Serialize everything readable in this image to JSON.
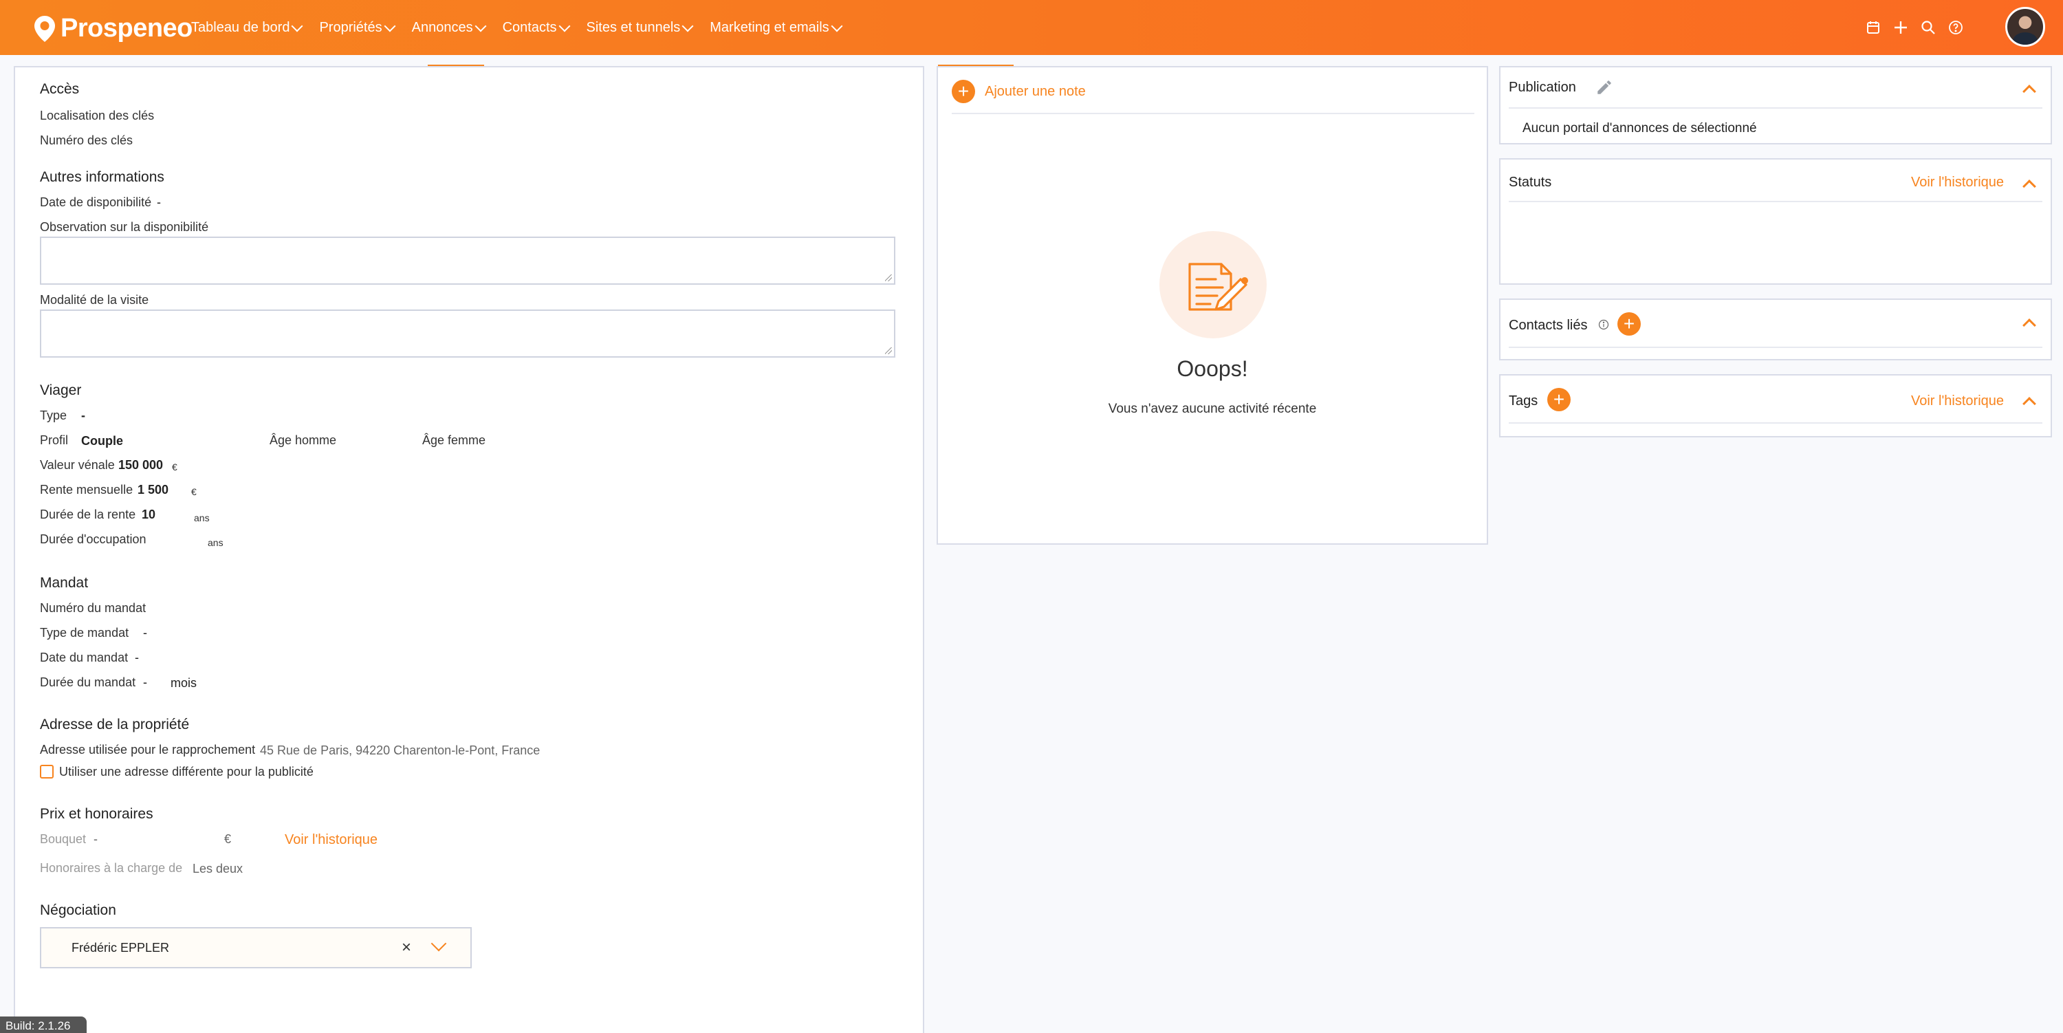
{
  "brand": {
    "name": "Prospeneo"
  },
  "nav": {
    "items": [
      {
        "label": "Tableau de bord"
      },
      {
        "label": "Propriétés"
      },
      {
        "label": "Annonces"
      },
      {
        "label": "Contacts"
      },
      {
        "label": "Sites et tunnels"
      },
      {
        "label": "Marketing et emails"
      }
    ]
  },
  "acces": {
    "title": "Accès",
    "localisation_cles": "Localisation des clés",
    "numero_cles": "Numéro des clés"
  },
  "autres": {
    "title": "Autres informations",
    "date_dispo_label": "Date de disponibilité",
    "date_dispo_value": "-",
    "observation_label": "Observation sur la disponibilité",
    "modalite_label": "Modalité de la visite"
  },
  "viager": {
    "title": "Viager",
    "type_label": "Type",
    "type_value": "-",
    "profil_label": "Profil",
    "profil_value": "Couple",
    "age_homme_label": "Âge homme",
    "age_femme_label": "Âge femme",
    "valeur_label": "Valeur vénale",
    "valeur_value": "150 000",
    "valeur_unit": "€",
    "rente_label": "Rente mensuelle",
    "rente_value": "1 500",
    "rente_unit": "€",
    "duree_rente_label": "Durée de la rente",
    "duree_rente_value": "10",
    "duree_rente_unit": "ans",
    "duree_occupation_label": "Durée d'occupation",
    "duree_occupation_unit": "ans"
  },
  "mandat": {
    "title": "Mandat",
    "numero_label": "Numéro du mandat",
    "type_label": "Type de mandat",
    "type_value": "-",
    "date_label": "Date du mandat",
    "date_value": "-",
    "duree_label": "Durée du mandat",
    "duree_value": "-",
    "duree_unit": "mois"
  },
  "adresse": {
    "title": "Adresse de la propriété",
    "rapprochement_label": "Adresse utilisée pour le rapprochement",
    "rapprochement_value": "45 Rue de Paris, 94220 Charenton-le-Pont, France",
    "checkbox_label": "Utiliser une adresse différente pour la publicité"
  },
  "prix": {
    "title": "Prix et honoraires",
    "bouquet_label": "Bouquet",
    "bouquet_value": "-",
    "bouquet_unit": "€",
    "historique_link": "Voir l'historique",
    "honoraires_label": "Honoraires à la charge de",
    "honoraires_value": "Les deux"
  },
  "negociation": {
    "title": "Négociation",
    "selected": "Frédéric EPPLER",
    "clear": "×"
  },
  "notes": {
    "add_label": "Ajouter une note",
    "empty_title": "Ooops!",
    "empty_text": "Vous n'avez aucune activité récente"
  },
  "right": {
    "publication_title": "Publication",
    "publication_text": "Aucun portail d'annonces de sélectionné",
    "statuts_title": "Statuts",
    "statuts_link": "Voir l'historique",
    "contacts_title": "Contacts liés",
    "tags_title": "Tags",
    "tags_link": "Voir l'historique"
  },
  "build": "Build: 2.1.26",
  "colors": {
    "accent": "#f7841f",
    "border": "#d9dce8"
  }
}
